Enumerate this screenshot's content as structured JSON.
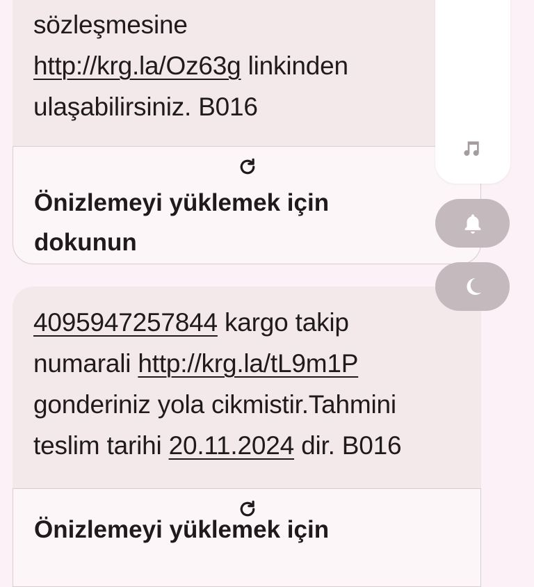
{
  "messages": [
    {
      "lines": [
        {
          "segments": [
            {
              "text": "sözleşmesine",
              "link": false
            }
          ]
        },
        {
          "segments": [
            {
              "text": "http://krg.la/Oz63g",
              "link": true
            },
            {
              "text": " linkinden",
              "link": false
            }
          ]
        },
        {
          "segments": [
            {
              "text": "ulaşabilirsiniz. B016",
              "link": false
            }
          ]
        }
      ],
      "preview": {
        "label_line1": "Önizlemeyi yüklemek için",
        "label_line2": "dokunun"
      }
    },
    {
      "lines": [
        {
          "segments": [
            {
              "text": "4095947257844",
              "link": true
            },
            {
              "text": " kargo takip",
              "link": false
            }
          ]
        },
        {
          "segments": [
            {
              "text": "numarali ",
              "link": false
            },
            {
              "text": "http://krg.la/tL9m1P",
              "link": true
            }
          ]
        },
        {
          "segments": [
            {
              "text": "gonderiniz yola cikmistir.Tahmini",
              "link": false
            }
          ]
        },
        {
          "segments": [
            {
              "text": "teslim tarihi ",
              "link": false
            },
            {
              "text": "20.11.2024",
              "link": true
            },
            {
              "text": " dir. B016",
              "link": false
            }
          ]
        }
      ],
      "preview": {
        "label_line1": "Önizlemeyi yüklemek için"
      }
    }
  ],
  "volume_panel": {
    "icons": [
      "music-note-icon",
      "bell-icon",
      "moon-icon"
    ]
  },
  "colors": {
    "background": "#fcf1f6",
    "bubble": "#f3e8ea",
    "preview": "#fdf6f8",
    "pill": "#c4babd",
    "text": "#1f1a1c"
  }
}
